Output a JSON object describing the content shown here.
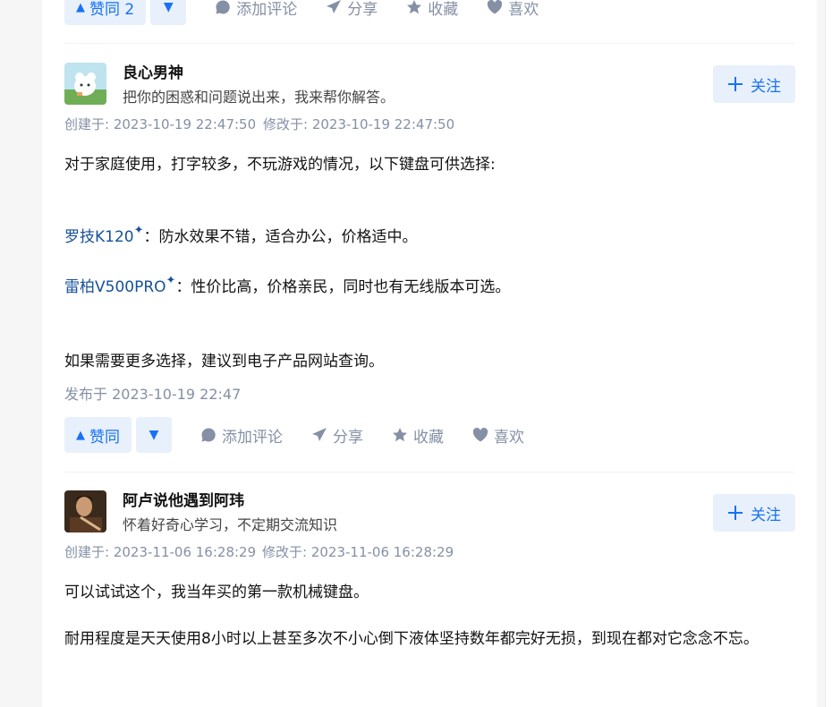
{
  "top_actions": {
    "vote_up": "赞同 2",
    "comment": "添加评论",
    "share": "分享",
    "collect": "收藏",
    "like": "喜欢"
  },
  "answers": [
    {
      "author": {
        "name": "良心男神",
        "bio": "把你的困惑和问题说出来，我来帮你解答。"
      },
      "follow": "关注",
      "created": "创建于: 2023-10-19 22:47:50",
      "modified": "修改于: 2023-10-19 22:47:50",
      "p1": "对于家庭使用，打字较多，不玩游戏的情况，以下键盘可供选择:",
      "kw1": "罗技K120",
      "p2_rest": "：防水效果不错，适合办公，价格适中。",
      "kw2": "雷柏V500PRO",
      "p3_rest": "：性价比高，价格亲民，同时也有无线版本可选。",
      "p4": "如果需要更多选择，建议到电子产品网站查询。",
      "published": "发布于 2023-10-19 22:47",
      "actions": {
        "vote_up": "赞同",
        "comment": "添加评论",
        "share": "分享",
        "collect": "收藏",
        "like": "喜欢"
      }
    },
    {
      "author": {
        "name": "阿卢说他遇到阿玮",
        "bio": "怀着好奇心学习，不定期交流知识"
      },
      "follow": "关注",
      "created": "创建于: 2023-11-06 16:28:29",
      "modified": "修改于: 2023-11-06 16:28:29",
      "p1": "可以试试这个，我当年买的第一款机械键盘。",
      "p2": "耐用程度是天天使用8小时以上甚至多次不小心倒下液体坚持数年都完好无损，到现在都对它念念不忘。"
    }
  ],
  "colors": {
    "accent": "#1772f6",
    "accent_bg": "#e8f0fb",
    "meta": "#8590a6",
    "keyword": "#175199"
  }
}
